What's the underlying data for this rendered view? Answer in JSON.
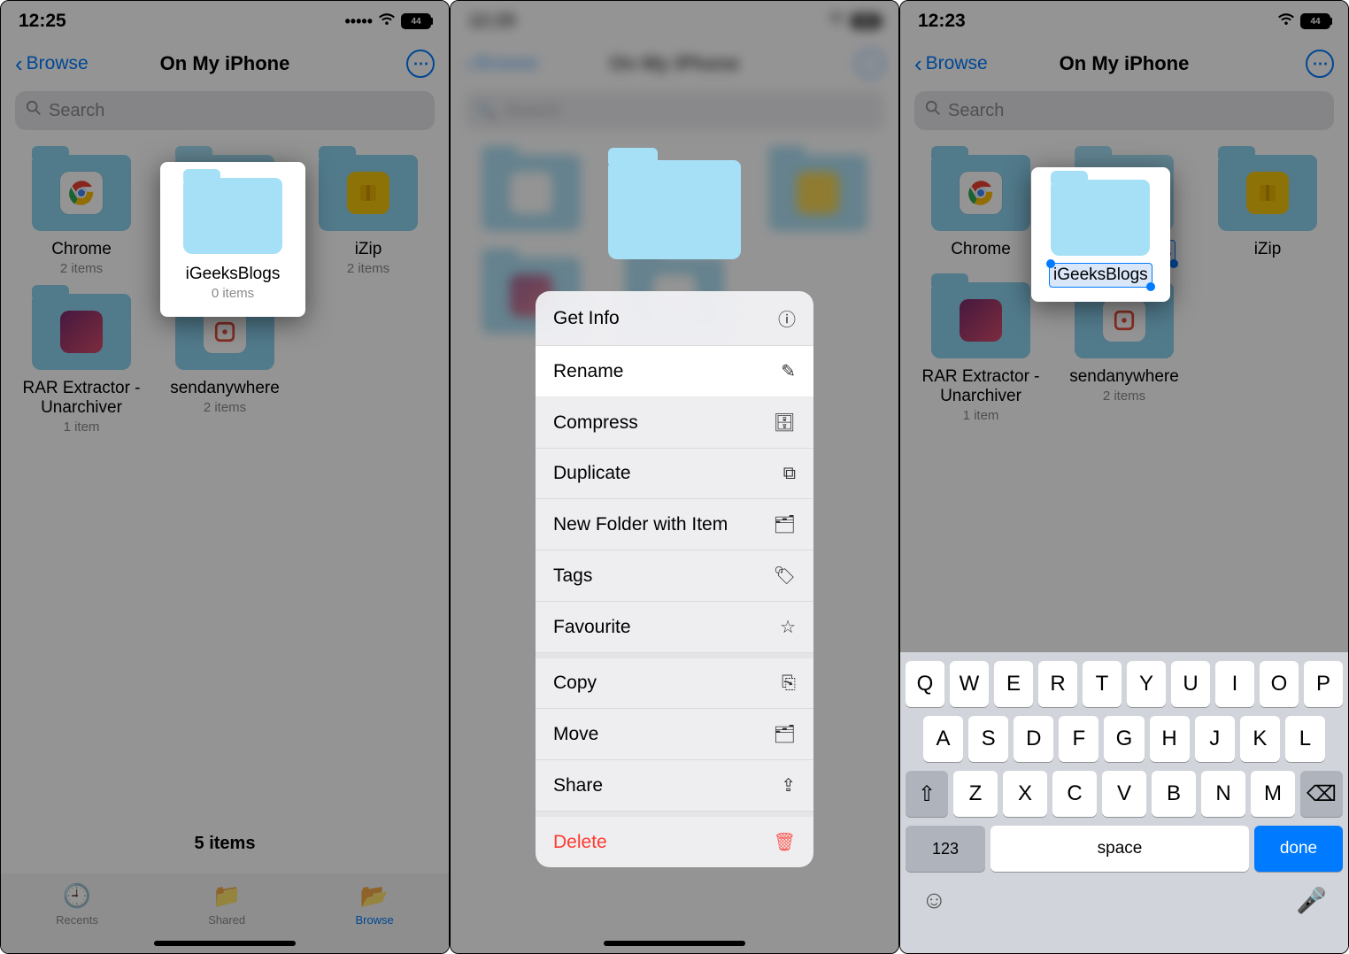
{
  "status": {
    "time1": "12:25",
    "time2": "12:25",
    "time3": "12:23",
    "battery": "44"
  },
  "nav": {
    "back": "Browse",
    "title": "On My iPhone"
  },
  "search_placeholder": "Search",
  "folders": [
    {
      "name": "Chrome",
      "meta": "2 items",
      "badge": "white"
    },
    {
      "name": "iGeeksBlogs",
      "meta": "0 items",
      "badge": "none"
    },
    {
      "name": "iZip",
      "meta": "2 items",
      "badge": "yellow"
    },
    {
      "name": "RAR Extractor - Unarchiver",
      "meta": "1 item",
      "badge": "purple"
    },
    {
      "name": "sendanywhere",
      "meta": "2 items",
      "badge": "red"
    }
  ],
  "item_count": "5 items",
  "tabs": {
    "recents": "Recents",
    "shared": "Shared",
    "browse": "Browse"
  },
  "menu": {
    "get_info": "Get Info",
    "rename": "Rename",
    "compress": "Compress",
    "duplicate": "Duplicate",
    "new_folder": "New Folder with Item",
    "tags": "Tags",
    "favourite": "Favourite",
    "copy": "Copy",
    "move": "Move",
    "share": "Share",
    "delete": "Delete"
  },
  "rename_value": "iGeeksBlogs",
  "keyboard": {
    "row1": [
      "Q",
      "W",
      "E",
      "R",
      "T",
      "Y",
      "U",
      "I",
      "O",
      "P"
    ],
    "row2": [
      "A",
      "S",
      "D",
      "F",
      "G",
      "H",
      "J",
      "K",
      "L"
    ],
    "row3": [
      "Z",
      "X",
      "C",
      "V",
      "B",
      "N",
      "M"
    ],
    "numeric": "123",
    "space": "space",
    "done": "done"
  }
}
